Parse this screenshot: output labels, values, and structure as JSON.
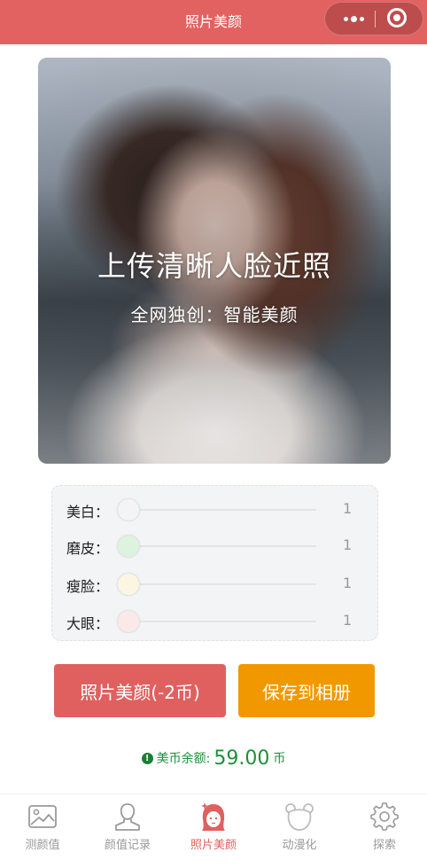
{
  "header": {
    "title": "照片美颜",
    "more_icon": "more-dots-icon",
    "close_icon": "target-close-icon",
    "bg_color": "#e26262"
  },
  "photo": {
    "headline": "上传清晰人脸近照",
    "subline": "全网独创：智能美颜"
  },
  "sliders": [
    {
      "label": "美白：",
      "value": "1",
      "thumb_color": "#f4f4f4"
    },
    {
      "label": "磨皮：",
      "value": "1",
      "thumb_color": "#dcf3dd"
    },
    {
      "label": "瘦脸：",
      "value": "1",
      "thumb_color": "#fbf5e2"
    },
    {
      "label": "大眼：",
      "value": "1",
      "thumb_color": "#fbe9e9"
    }
  ],
  "buttons": {
    "beauty_label": "照片美颜(-2币)",
    "save_label": "保存到相册",
    "beauty_color": "#e06060",
    "save_color": "#f19800"
  },
  "balance": {
    "label": "美币余额:",
    "amount": "59.00",
    "unit": "币",
    "color": "#1f8f3a"
  },
  "tabbar": {
    "active_color": "#e06060",
    "items": [
      {
        "label": "测颜值",
        "icon": "image-icon"
      },
      {
        "label": "颜值记录",
        "icon": "person-icon"
      },
      {
        "label": "照片美颜",
        "icon": "girl-face-icon",
        "active": true
      },
      {
        "label": "动漫化",
        "icon": "bear-icon"
      },
      {
        "label": "探索",
        "icon": "gear-icon"
      }
    ]
  }
}
